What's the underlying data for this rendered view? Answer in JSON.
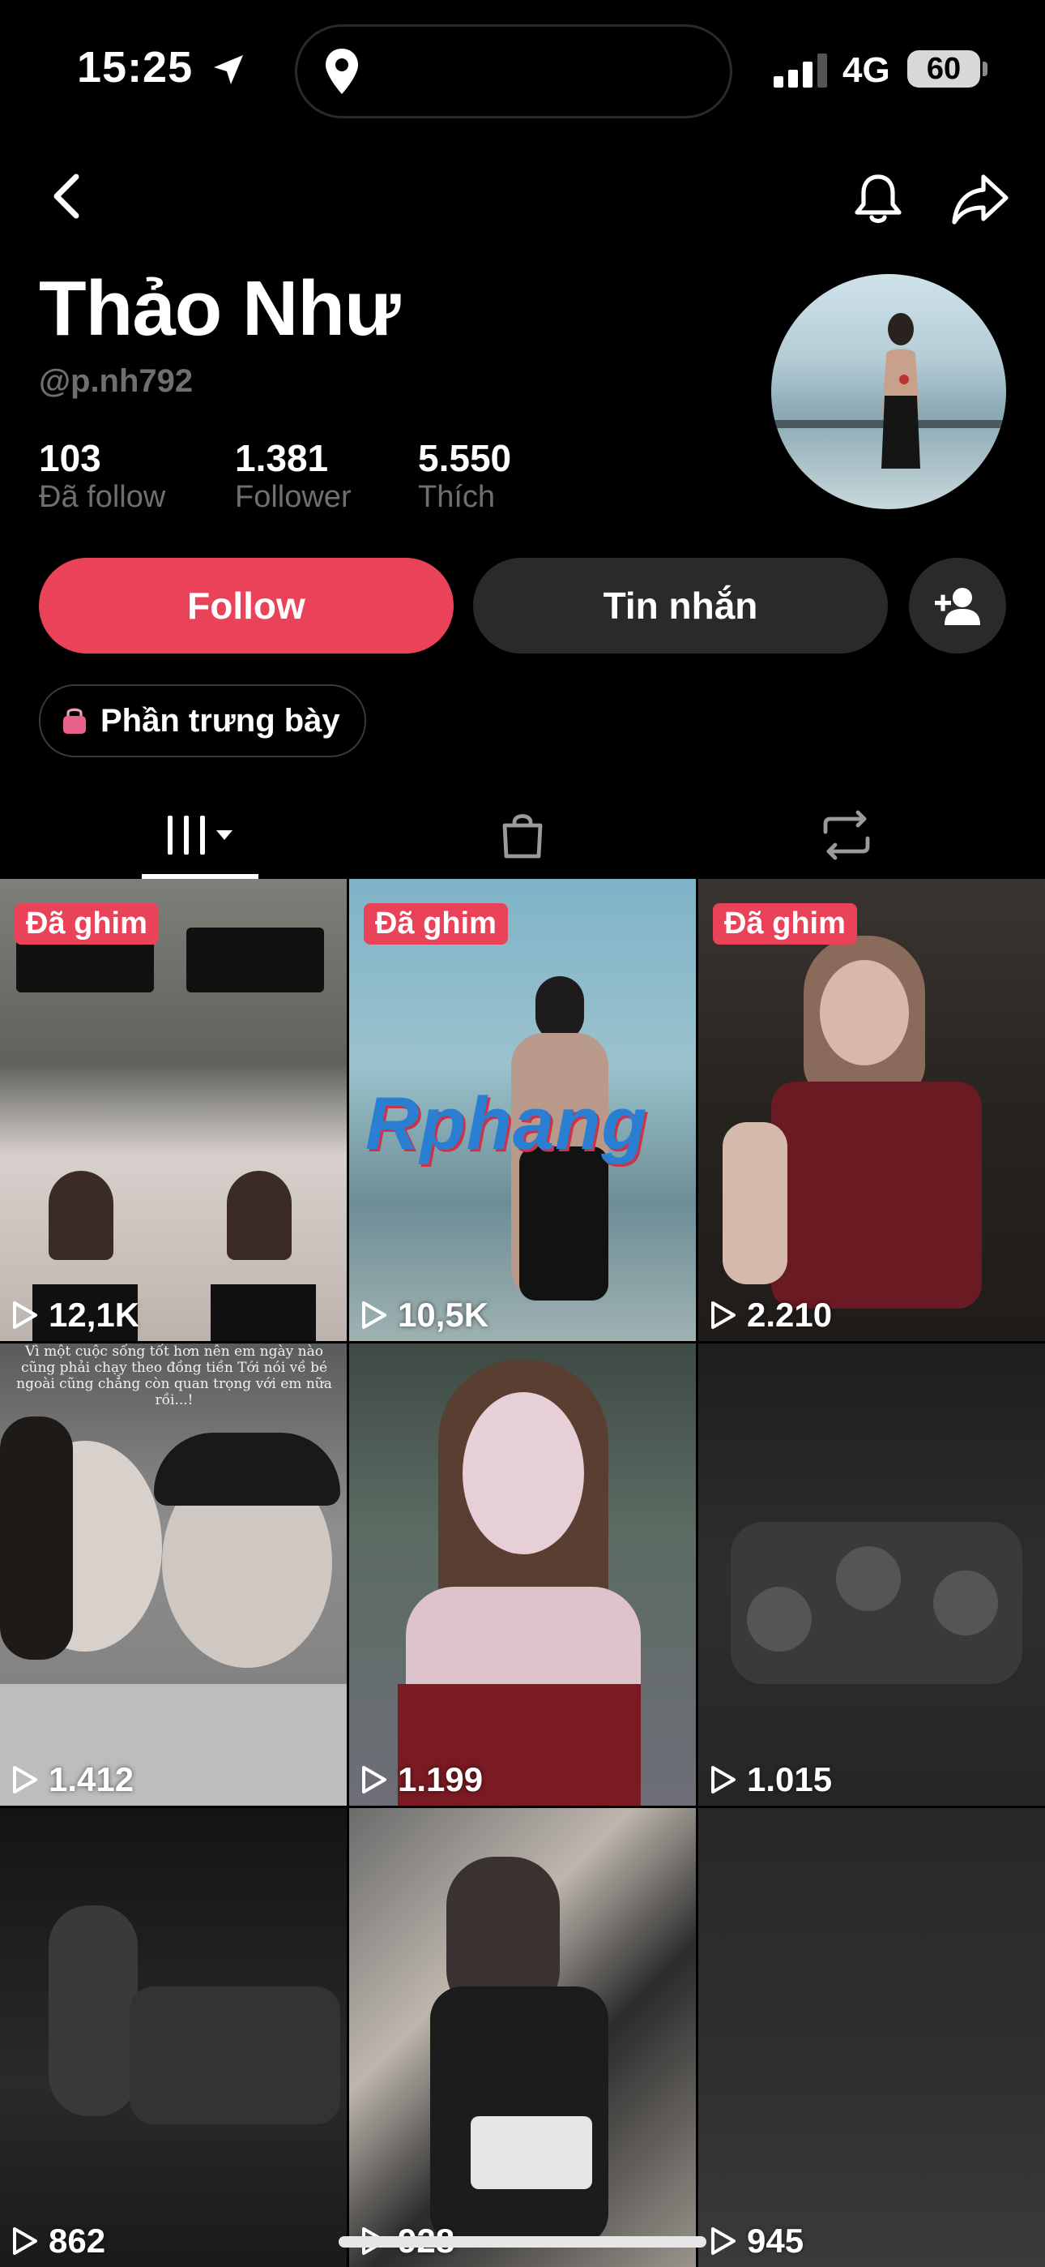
{
  "status_bar": {
    "time": "15:25",
    "network": "4G",
    "battery": "60"
  },
  "profile": {
    "name": "Thảo Như",
    "handle": "@p.nh792",
    "stats": [
      {
        "value": "103",
        "label": "Đã follow"
      },
      {
        "value": "1.381",
        "label": "Follower"
      },
      {
        "value": "5.550",
        "label": "Thích"
      }
    ]
  },
  "actions": {
    "follow_label": "Follow",
    "message_label": "Tin nhắn",
    "showcase_label": "Phần trưng bày"
  },
  "tabs": [
    "videos-grid",
    "shop",
    "reposts"
  ],
  "videos": [
    {
      "pinned_label": "Đã ghim",
      "views": "12,1K"
    },
    {
      "pinned_label": "Đã ghim",
      "views": "10,5K",
      "overlay_text": "Rphang"
    },
    {
      "pinned_label": "Đã ghim",
      "views": "2.210"
    },
    {
      "pinned_label": "",
      "views": "1.412",
      "caption": "Vì một cuộc sống tốt hơn nên em ngày nào cũng phải chạy theo đồng tiền Tới nói về bé ngoài cũng chẳng còn quan trọng với em nữa rồi...!"
    },
    {
      "pinned_label": "",
      "views": "1.199"
    },
    {
      "pinned_label": "",
      "views": "1.015"
    },
    {
      "pinned_label": "",
      "views": "862"
    },
    {
      "pinned_label": "",
      "views": "928"
    },
    {
      "pinned_label": "",
      "views": "945"
    }
  ],
  "colors": {
    "accent": "#ea4359",
    "background": "#000000",
    "muted_text": "#6f6f6f",
    "button_dark": "#2a2a2a"
  }
}
